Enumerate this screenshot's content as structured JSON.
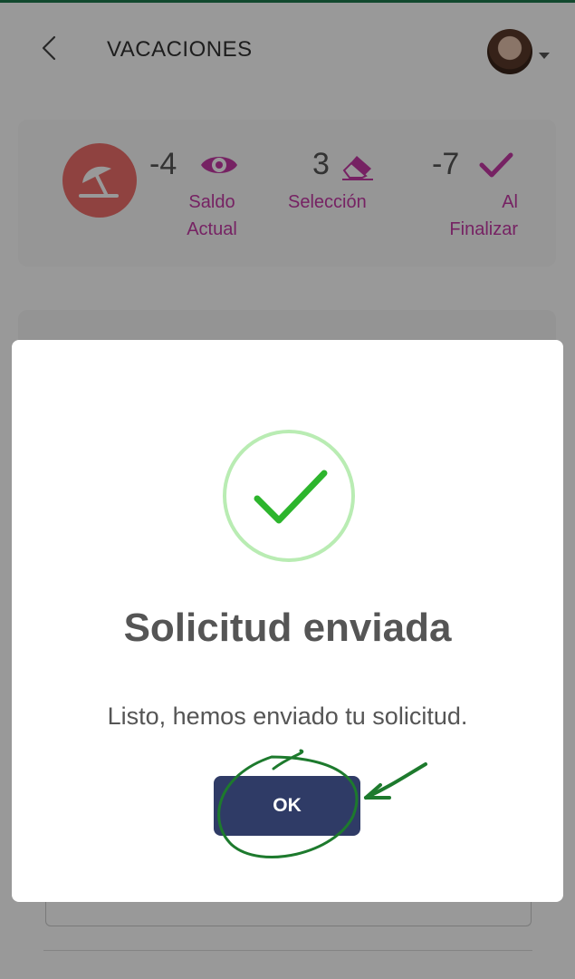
{
  "header": {
    "title": "VACACIONES"
  },
  "summary": {
    "stats": [
      {
        "value": "-4",
        "label": "Saldo Actual",
        "icon": "eye-icon"
      },
      {
        "value": "3",
        "label": "Selección",
        "icon": "eraser-icon"
      },
      {
        "value": "-7",
        "label": "Al Finalizar",
        "icon": "check-icon"
      }
    ],
    "accent_color": "#c53aa6",
    "beach_color": "#ee6f6c"
  },
  "modal": {
    "title": "Solicitud enviada",
    "message": "Listo, hemos enviado tu solicitud.",
    "ok_label": "OK",
    "success_color": "#2db52d",
    "button_color": "#2f3b66"
  },
  "annotation": {
    "color": "#1d7a2d"
  }
}
